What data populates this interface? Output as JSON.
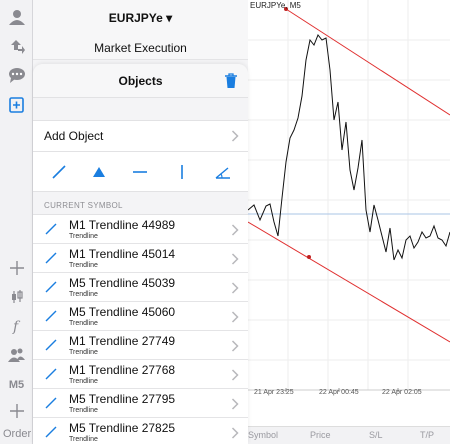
{
  "header": {
    "symbol": "EURJPYe ▾",
    "market_execution": "Market Execution"
  },
  "panel": {
    "title": "Objects",
    "add_object": "Add Object",
    "section_header": "CURRENT SYMBOL",
    "tools": [
      "trendline-tool-icon",
      "triangle-tool-icon",
      "horizontal-line-tool-icon",
      "vertical-line-tool-icon",
      "angle-tool-icon"
    ],
    "items": [
      {
        "title": "M1 Trendline 44989",
        "subtitle": "Trendline"
      },
      {
        "title": "M1 Trendline 45014",
        "subtitle": "Trendline"
      },
      {
        "title": "M5 Trendline 45039",
        "subtitle": "Trendline"
      },
      {
        "title": "M5 Trendline 45060",
        "subtitle": "Trendline"
      },
      {
        "title": "M1 Trendline 27749",
        "subtitle": "Trendline"
      },
      {
        "title": "M1 Trendline 27768",
        "subtitle": "Trendline"
      },
      {
        "title": "M5 Trendline 27795",
        "subtitle": "Trendline"
      },
      {
        "title": "M5 Trendline 27825",
        "subtitle": "Trendline"
      }
    ]
  },
  "toolbar": {
    "timeframe": "M5",
    "order": "Order"
  },
  "chart": {
    "title": "EURJPYe, M5",
    "time_labels": [
      "21 Apr 23:25",
      "22 Apr 00:45",
      "22 Apr 02:05"
    ]
  },
  "bottom_bar": {
    "symbol": "Symbol",
    "price": "Price",
    "sl": "S/L",
    "tp": "T/P"
  },
  "colors": {
    "accent": "#1a7ee0",
    "trendline": "#e03030",
    "price_line": "#111111"
  }
}
